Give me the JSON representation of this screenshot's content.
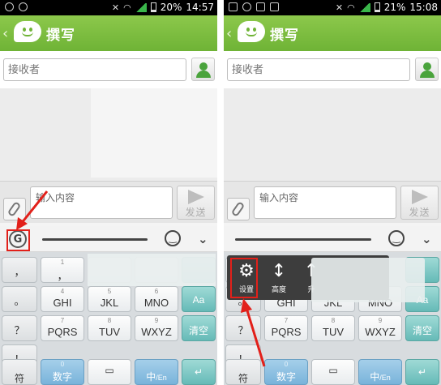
{
  "left_screen": {
    "status_time": "14:57",
    "battery_percent": "20%",
    "title": "撰写",
    "recipient_placeholder": "接收者",
    "content_placeholder": "输入内容",
    "send_label": "发送",
    "keyboard": {
      "row1": [
        {
          "num": "1",
          "main": "，"
        },
        {
          "num": "",
          "main": ""
        }
      ],
      "row2": [
        {
          "num": "4",
          "main": "GHI"
        },
        {
          "num": "5",
          "main": "JKL"
        },
        {
          "num": "6",
          "main": "MNO"
        }
      ],
      "row3": [
        {
          "num": "7",
          "main": "PQRS"
        },
        {
          "num": "8",
          "main": "TUV"
        },
        {
          "num": "9",
          "main": "WXYZ"
        }
      ],
      "side_keys": [
        "，",
        "。",
        "？",
        "！"
      ],
      "func_keys": [
        "Aa",
        "清空"
      ],
      "bottom": {
        "symbol": "符",
        "number": "数字",
        "zero": "0",
        "lang": "中",
        "lang_sub": "/En",
        "enter": "↵"
      }
    }
  },
  "right_screen": {
    "status_time": "15:08",
    "battery_percent": "21%",
    "title": "撰写",
    "recipient_placeholder": "接收者",
    "content_placeholder": "输入内容",
    "send_label": "发送",
    "popup": {
      "settings_label": "设置",
      "height_label": "高度",
      "upgrade_label": "升"
    },
    "keyboard": {
      "row2": [
        {
          "num": "4",
          "main": "GHI"
        },
        {
          "num": "5",
          "main": "JKL"
        },
        {
          "num": "6",
          "main": "MNO"
        }
      ],
      "row3": [
        {
          "num": "7",
          "main": "PQRS"
        },
        {
          "num": "8",
          "main": "TUV"
        },
        {
          "num": "9",
          "main": "WXYZ"
        }
      ],
      "side_keys": [
        "，",
        "。",
        "？",
        "！"
      ],
      "func_keys": [
        "Aa",
        "清空"
      ],
      "bottom": {
        "symbol": "符",
        "number": "数字",
        "zero": "0",
        "lang": "中",
        "lang_sub": "/En",
        "enter": "↵"
      }
    }
  },
  "icons": {
    "settings": "gear-icon",
    "height": "vertical-arrows-icon",
    "upgrade": "up-arrow-icon",
    "emoji": "smiley-icon",
    "collapse": "double-chevron-down-icon"
  },
  "colors": {
    "title_bar": "#7cbd3f",
    "func_key": "#66bab7",
    "annotation": "#e2201a"
  }
}
